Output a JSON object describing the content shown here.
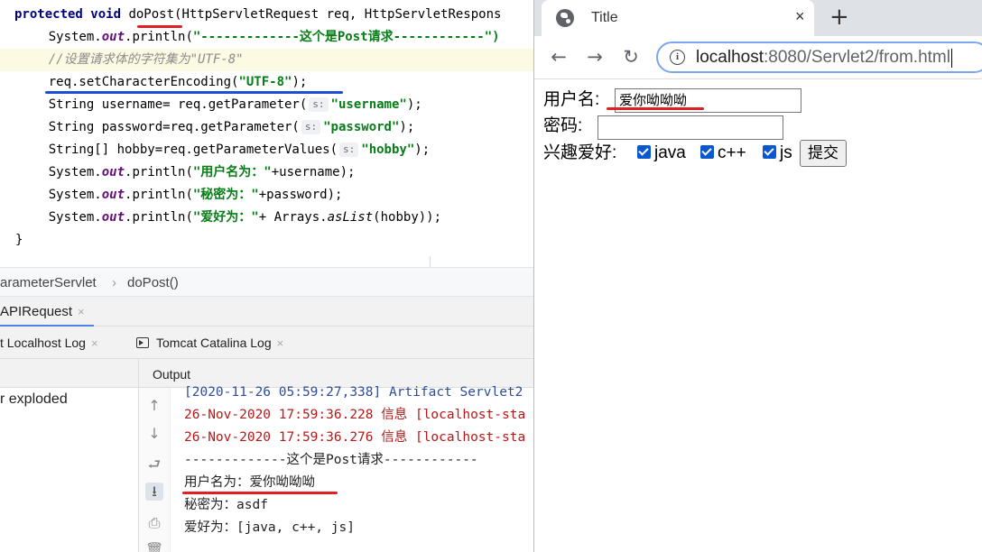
{
  "ide": {
    "code": {
      "l1_kw": "protected void ",
      "l1_method": "doPost",
      "l1_rest": "(HttpServletRequest req, HttpServletRespons",
      "l2_a": "    System.",
      "l2_out": "out",
      "l2_b": ".println(",
      "l2_str": "\"-------------这个是Post请求------------\")",
      "l3_comment": "    //设置请求体的字符集为\"UTF-8\"",
      "l4_a": "    req.setCharacterEncoding(",
      "l4_str": "\"UTF-8\"",
      "l4_b": ");",
      "l5_a": "    String username= req.getParameter(",
      "l5_hint": "s:",
      "l5_str": "\"username\"",
      "l5_b": ");",
      "l6_a": "    String password=req.getParameter(",
      "l6_hint": "s:",
      "l6_str": "\"password\"",
      "l6_b": ");",
      "l7_a": "    String[] hobby=req.getParameterValues(",
      "l7_hint": "s:",
      "l7_str": "\"hobby\"",
      "l7_b": ");",
      "l8_a": "    System.",
      "l8_out": "out",
      "l8_b": ".println(",
      "l8_str": "\"用户名为：\"",
      "l8_c": "+username);",
      "l9_a": "    System.",
      "l9_out": "out",
      "l9_b": ".println(",
      "l9_str": "\"秘密为：\"",
      "l9_c": "+password);",
      "l10_a": "    System.",
      "l10_out": "out",
      "l10_b": ".println(",
      "l10_str": "\"爱好为：\"",
      "l10_c": "+ Arrays.",
      "l10_aslist": "asList",
      "l10_d": "(hobby));",
      "l11": "}"
    },
    "breadcrumb": {
      "class_name": "arameterServlet",
      "separator": "›",
      "method": "doPost()"
    },
    "run_tab": {
      "label": "APIRequest",
      "close": "×"
    },
    "log_tabs": [
      {
        "label": "t Localhost Log",
        "close": "×"
      },
      {
        "label": "Tomcat Catalina Log",
        "close": "×"
      }
    ],
    "deploy_item": "r exploded",
    "output_label": "Output",
    "tools": [
      "arrow-up-icon",
      "arrow-down-icon",
      "soft-wrap-icon",
      "scroll-to-end-icon",
      "print-icon",
      "trash-icon"
    ],
    "console": [
      "[2020-11-26 05:59:27,338] Artifact Servlet2",
      "26-Nov-2020 17:59:36.228 信息 [localhost-sta",
      "26-Nov-2020 17:59:36.276 信息 [localhost-sta",
      "-------------这个是Post请求------------",
      "用户名为：爱你呦呦呦",
      "秘密为：asdf",
      "爱好为：[java, c++, js]"
    ]
  },
  "browser": {
    "tab_title": "Title",
    "tab_close": "×",
    "new_tab": "+",
    "url_host": "localhost",
    "url_path": ":8080/Servlet2/from.html",
    "info_icon": "i",
    "form": {
      "username_label": "用户名:",
      "username_value": "爱你呦呦呦",
      "password_label": "密码:",
      "password_value": "",
      "hobby_label": "兴趣爱好:",
      "hobbies": [
        "java",
        "c++",
        "js"
      ],
      "submit_label": "提交"
    }
  }
}
